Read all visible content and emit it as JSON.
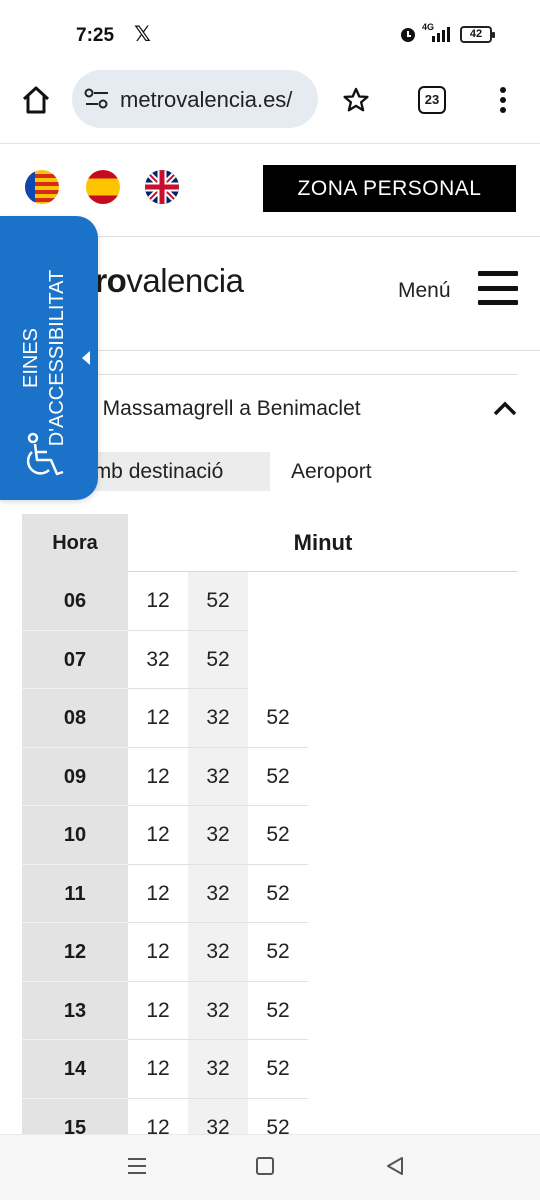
{
  "status_bar": {
    "time": "7:25",
    "x_app": "𝕏",
    "network": "4G",
    "battery": "42"
  },
  "browser": {
    "url": "metrovalencia.es/",
    "tab_count": "23"
  },
  "header": {
    "languages": [
      "valencian-flag",
      "spanish-flag",
      "uk-flag"
    ],
    "zona_personal": "ZONA PERSONAL",
    "logo_bold": "etro",
    "logo_rest": "valencia",
    "menu_label": "Menú"
  },
  "accessibility": {
    "line1": "EINES",
    "line2": "D'ACCESSIBILITAT"
  },
  "route": {
    "title": "De Massamagrell a Benimaclet",
    "tabs": [
      "Trens amb destinació",
      "Aeroport"
    ],
    "tab_visible_text": "ns amb destinació"
  },
  "timetable": {
    "col_hour": "Hora",
    "col_minute": "Minut",
    "rows": [
      {
        "hour": "06",
        "mins": [
          "12",
          "52",
          ""
        ]
      },
      {
        "hour": "07",
        "mins": [
          "32",
          "52",
          ""
        ]
      },
      {
        "hour": "08",
        "mins": [
          "12",
          "32",
          "52"
        ]
      },
      {
        "hour": "09",
        "mins": [
          "12",
          "32",
          "52"
        ]
      },
      {
        "hour": "10",
        "mins": [
          "12",
          "32",
          "52"
        ]
      },
      {
        "hour": "11",
        "mins": [
          "12",
          "32",
          "52"
        ]
      },
      {
        "hour": "12",
        "mins": [
          "12",
          "32",
          "52"
        ]
      },
      {
        "hour": "13",
        "mins": [
          "12",
          "32",
          "52"
        ]
      },
      {
        "hour": "14",
        "mins": [
          "12",
          "32",
          "52"
        ]
      },
      {
        "hour": "15",
        "mins": [
          "12",
          "32",
          "52"
        ]
      }
    ]
  },
  "colors": {
    "accessibility_blue": "#1a73c8",
    "zona_bg": "#000000",
    "hour_cell": "#e3e3e3"
  }
}
